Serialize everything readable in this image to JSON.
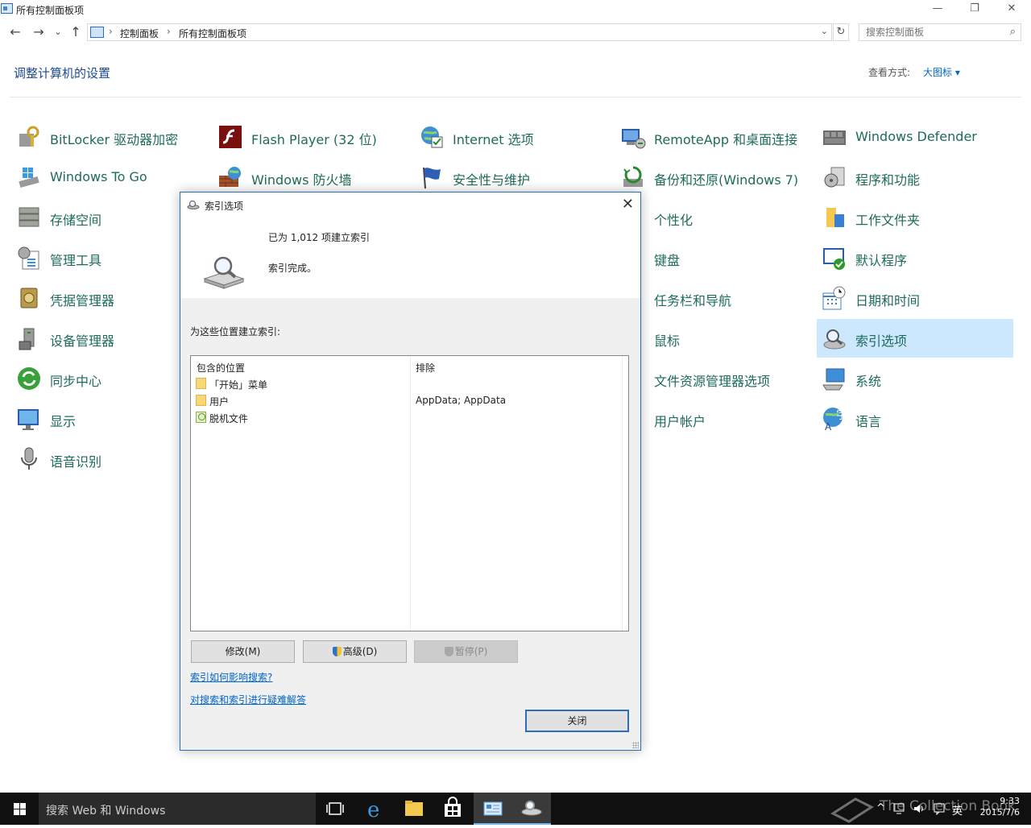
{
  "window": {
    "title": "所有控制面板项",
    "min": "—",
    "max": "❐",
    "close": "✕"
  },
  "nav": {
    "back": "←",
    "forward": "→",
    "recent": "⌄",
    "up": "↑",
    "breadcrumb": [
      "控制面板",
      "所有控制面板项"
    ],
    "refresh": "↻",
    "search_placeholder": "搜索控制面板"
  },
  "header": {
    "title": "调整计算机的设置",
    "view_label": "查看方式:",
    "view_value": "大图标 ▾"
  },
  "items": [
    {
      "label": "BitLocker 驱动器加密",
      "icon": "bitlocker-icon"
    },
    {
      "label": "Flash Player (32 位)",
      "icon": "flash-icon"
    },
    {
      "label": "Internet 选项",
      "icon": "internet-options-icon"
    },
    {
      "label": "RemoteApp 和桌面连接",
      "icon": "remoteapp-icon"
    },
    {
      "label": "Windows Defender",
      "icon": "defender-icon"
    },
    {
      "label": "Windows To Go",
      "icon": "windows-to-go-icon"
    },
    {
      "label": "Windows 防火墙",
      "icon": "firewall-icon"
    },
    {
      "label": "安全性与维护",
      "icon": "security-flag-icon"
    },
    {
      "label": "备份和还原(Windows 7)",
      "icon": "backup-icon"
    },
    {
      "label": "程序和功能",
      "icon": "programs-icon"
    },
    {
      "label": "存储空间",
      "icon": "storage-icon"
    },
    {
      "label": "个性化",
      "icon": "personalization-icon"
    },
    {
      "label": "工作文件夹",
      "icon": "work-folders-icon"
    },
    {
      "label": "管理工具",
      "icon": "admin-tools-icon"
    },
    {
      "label": "键盘",
      "icon": "keyboard-icon"
    },
    {
      "label": "默认程序",
      "icon": "default-programs-icon"
    },
    {
      "label": "凭据管理器",
      "icon": "credential-icon"
    },
    {
      "label": "任务栏和导航",
      "icon": "taskbar-icon"
    },
    {
      "label": "日期和时间",
      "icon": "calendar-clock-icon"
    },
    {
      "label": "设备管理器",
      "icon": "device-manager-icon"
    },
    {
      "label": "鼠标",
      "icon": "mouse-icon"
    },
    {
      "label": "索引选项",
      "icon": "indexing-icon"
    },
    {
      "label": "同步中心",
      "icon": "sync-icon"
    },
    {
      "label": "文件资源管理器选项",
      "icon": "folder-options-icon"
    },
    {
      "label": "系统",
      "icon": "system-icon"
    },
    {
      "label": "显示",
      "icon": "display-icon"
    },
    {
      "label": "用户帐户",
      "icon": "user-accounts-icon"
    },
    {
      "label": "语言",
      "icon": "language-icon"
    },
    {
      "label": "语音识别",
      "icon": "microphone-icon"
    }
  ],
  "dialog": {
    "title": "索引选项",
    "close": "✕",
    "count_text": "已为 1,012 项建立索引",
    "status_text": "索引完成。",
    "locations_label": "为这些位置建立索引:",
    "col_included": "包含的位置",
    "col_excluded": "排除",
    "rows": [
      {
        "name": "「开始」菜单",
        "exclude": ""
      },
      {
        "name": "用户",
        "exclude": "AppData; AppData"
      },
      {
        "name": "脱机文件",
        "exclude": ""
      }
    ],
    "modify_button": "修改(M)",
    "advanced_button": "高级(D)",
    "pause_button": "暂停(P)",
    "link_search": "索引如何影响搜索?",
    "link_troubleshoot": "对搜索和索引进行疑难解答",
    "close_button": "关闭"
  },
  "taskbar": {
    "search_text": "搜索 Web 和 Windows",
    "tray_arrow": "^",
    "ime": "英",
    "time": "9:33",
    "date": "2015/7/6",
    "watermark": "The Collection Book"
  }
}
